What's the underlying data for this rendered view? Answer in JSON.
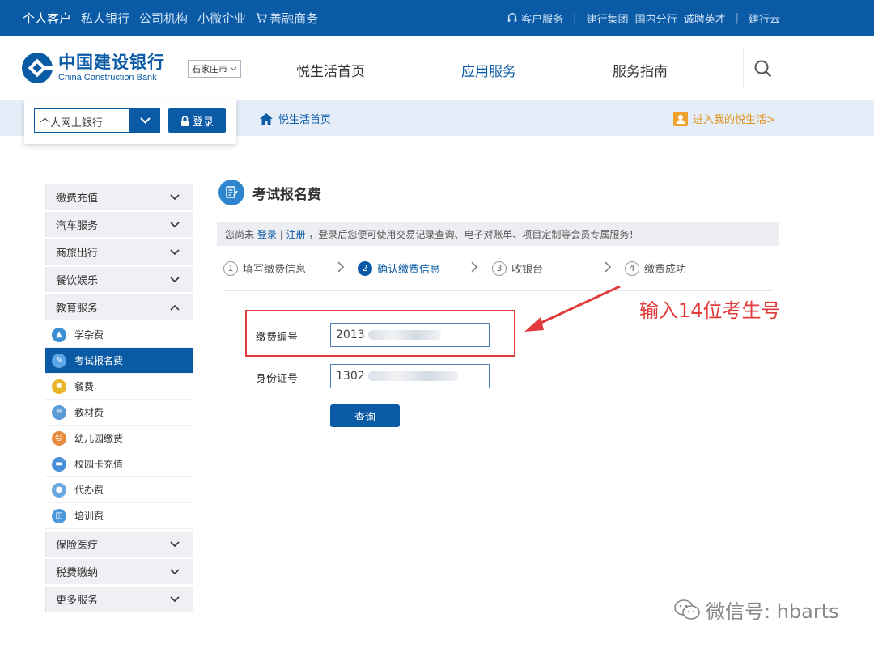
{
  "topbar": {
    "segments": [
      "个人客户",
      "私人银行",
      "公司机构",
      "小微企业",
      "善融商务"
    ],
    "right": {
      "service": "客户服务",
      "links": [
        "建行集团",
        "国内分行",
        "诚聘英才",
        "建行云"
      ]
    }
  },
  "header": {
    "logo_cn": "中国建设银行",
    "logo_en": "China Construction Bank",
    "city": "石家庄市",
    "nav": [
      "悦生活首页",
      "应用服务",
      "服务指南"
    ]
  },
  "login": {
    "select_value": "个人网上银行",
    "button": "登录"
  },
  "breadcrumb": "悦生活首页",
  "my_life": "进入我的悦生活>",
  "sidebar": {
    "categories_top": [
      "缴费充值",
      "汽车服务",
      "商旅出行",
      "餐饮娱乐",
      "教育服务"
    ],
    "education_items": [
      "学杂费",
      "考试报名费",
      "餐费",
      "教材费",
      "幼儿园缴费",
      "校园卡充值",
      "代办费",
      "培训费"
    ],
    "categories_bottom": [
      "保险医疗",
      "税费缴纳",
      "更多服务"
    ],
    "active_item": "考试报名费"
  },
  "content": {
    "title": "考试报名费",
    "notice": {
      "prefix": "您尚未",
      "login": "登录",
      "sep": "|",
      "register": "注册",
      "suffix": "，登录后您便可使用交易记录查询、电子对账单、项目定制等会员专属服务！"
    },
    "steps": [
      {
        "num": "1",
        "label": "填写缴费信息"
      },
      {
        "num": "2",
        "label": "确认缴费信息"
      },
      {
        "num": "3",
        "label": "收银台"
      },
      {
        "num": "4",
        "label": "缴费成功"
      }
    ],
    "form": {
      "payment_no_label": "缴费编号",
      "payment_no_value": "2013",
      "id_label": "身份证号",
      "id_value": "1302",
      "query_button": "查询"
    }
  },
  "annotation": "输入14位考生号",
  "watermark": "微信号: hbarts",
  "colors": {
    "brand_blue": "#0a5aa6",
    "annotation_red": "#e23b3b",
    "orange": "#e0921e"
  }
}
